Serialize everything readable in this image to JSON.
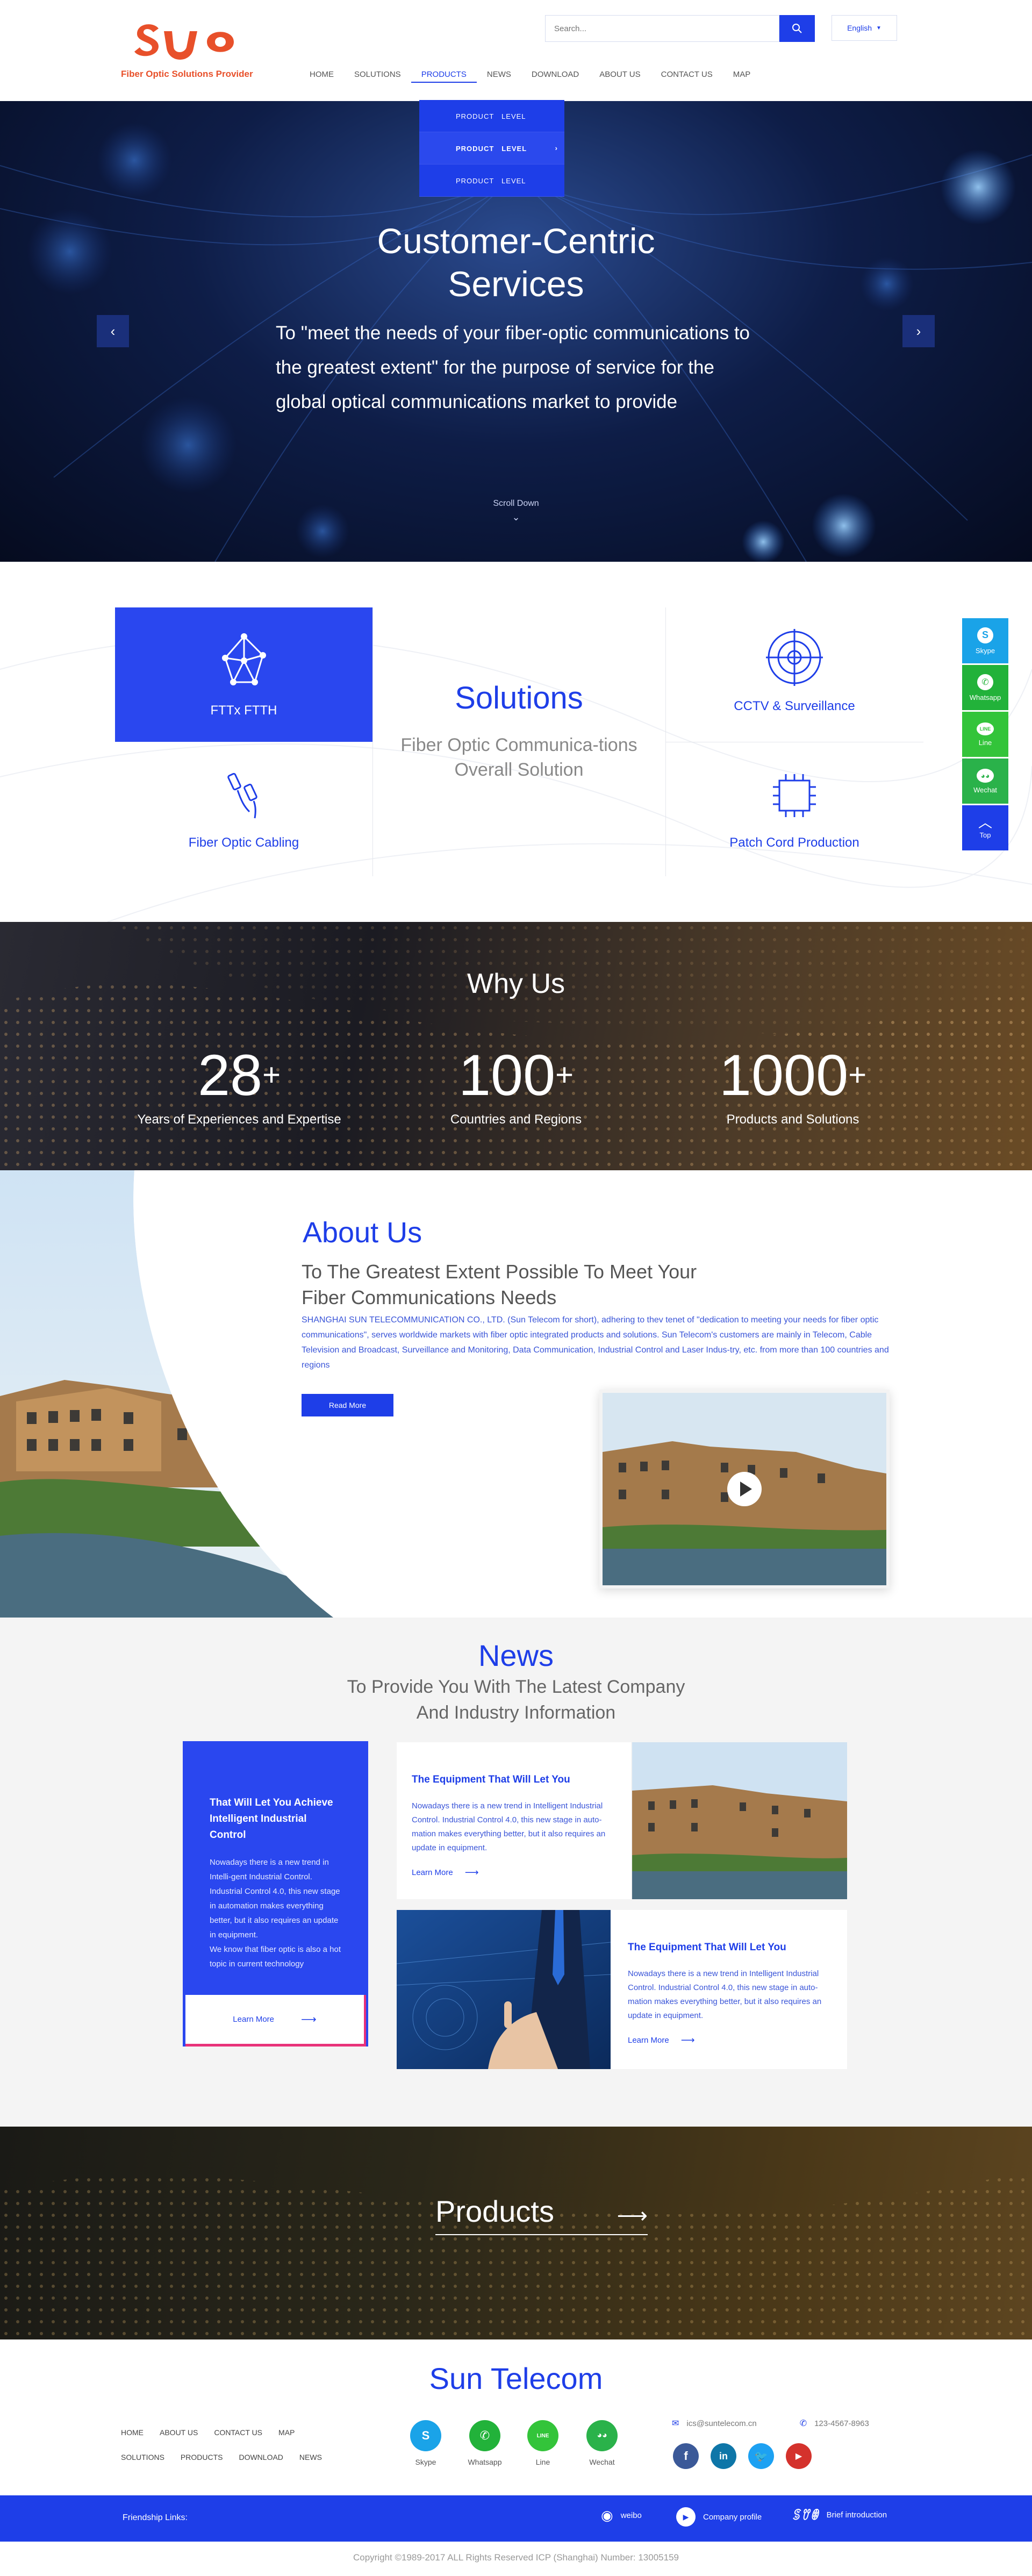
{
  "header": {
    "tagline": "Fiber Optic Solutions Provider",
    "search_placeholder": "Search...",
    "language": "English",
    "nav": [
      "HOME",
      "SOLUTIONS",
      "PRODUCTS",
      "NEWS",
      "DOWNLOAD",
      "ABOUT US",
      "CONTACT US",
      "MAP"
    ],
    "active_nav": "PRODUCTS",
    "dropdown": [
      "PRODUCT　LEVEL",
      "PRODUCT　LEVEL",
      "PRODUCT　LEVEL"
    ]
  },
  "hero": {
    "title": "Customer-Centric Services",
    "text": "To \"meet the needs of your fiber-optic communications to the greatest extent\" for the purpose of service for the global optical communications market to provide",
    "scroll": "Scroll Down"
  },
  "solutions": {
    "title": "Solutions",
    "subtitle": "Fiber Optic Communica-tions Overall Solution",
    "items": [
      {
        "label": "FTTx FTTH",
        "icon": "network-icon"
      },
      {
        "label": "CCTV & Surveillance",
        "icon": "target-icon"
      },
      {
        "label": "Fiber Optic Cabling",
        "icon": "cable-icon"
      },
      {
        "label": "Patch Cord Production",
        "icon": "chip-icon"
      }
    ]
  },
  "side_bar": [
    {
      "label": "Skype",
      "color": "#1aa3e8"
    },
    {
      "label": "Whatsapp",
      "color": "#22b23a"
    },
    {
      "label": "Line",
      "color": "#33c43a"
    },
    {
      "label": "Wechat",
      "color": "#2ab24a"
    },
    {
      "label": "Top",
      "color": "#1e3ee8"
    }
  ],
  "why": {
    "title": "Why Us",
    "stats": [
      {
        "num": "28",
        "plus": "+",
        "label": "Years of Experiences and Expertise"
      },
      {
        "num": "100",
        "plus": "+",
        "label": "Countries and Regions"
      },
      {
        "num": "1000",
        "plus": "+",
        "label": "Products and  Solutions"
      }
    ]
  },
  "about": {
    "title": "About Us",
    "subtitle": "To The Greatest Extent Possible To Meet Your Fiber Communications Needs",
    "text": "SHANGHAI SUN TELECOMMUNICATION CO., LTD. (Sun Telecom for short), adhering to thev tenet of \"dedication to meeting your needs for fiber optic communications\", serves worldwide markets with fiber optic integrated products and solutions. Sun Telecom's customers are mainly in Telecom, Cable Television and Broadcast, Surveillance and Monitoring, Data Communication, Industrial Control and Laser Indus-try, etc. from more than 100 countries and regions",
    "read_more": "Read More"
  },
  "news": {
    "title": "News",
    "subtitle": "To Provide You With The Latest Company And Industry  Information",
    "feature": {
      "title": "That Will Let You Achieve Intelligent Industrial Control",
      "text": "Nowadays there is a new trend in Intelli-gent Industrial Control. Industrial Control 4.0, this new stage in automation makes everything better, but it also requires an update in equipment.",
      "text2": "We know that fiber optic is also a hot topic in current technology",
      "more": "Learn More"
    },
    "cards": [
      {
        "title": "The Equipment That Will Let You",
        "text": "Nowadays there is a new trend in Intelligent Industrial Control. Industrial Control 4.0, this new stage in auto-mation makes everything better, but it also requires an update in equipment.",
        "more": "Learn More"
      },
      {
        "title": "The Equipment That Will Let You",
        "text": "Nowadays there is a new trend in Intelligent Industrial Control. Industrial Control 4.0, this new stage in auto-mation makes everything better, but it also requires an update in equipment.",
        "more": "Learn More"
      }
    ]
  },
  "products": {
    "label": "Products"
  },
  "footer": {
    "brand": "Sun  Telecom",
    "links_row1": [
      "HOME",
      "ABOUT US",
      "CONTACT US",
      "MAP"
    ],
    "links_row2": [
      "SOLUTIONS",
      "PRODUCTS",
      "DOWNLOAD",
      "NEWS"
    ],
    "socials": [
      {
        "label": "Skype",
        "color": "#1aa3e8"
      },
      {
        "label": "Whatsapp",
        "color": "#22b23a"
      },
      {
        "label": "Line",
        "color": "#33c43a"
      },
      {
        "label": "Wechat",
        "color": "#2ab24a"
      }
    ],
    "email": "ics@suntelecom.cn",
    "phone": "123-4567-8963",
    "friendship": "Friendship Links:",
    "friend_links": [
      "weibo",
      "Company profile",
      "Brief introduction"
    ],
    "copyright": "Copyright ©1989-2017  ALL Rights Reserved    ICP (Shanghai) Number: 13005159"
  }
}
